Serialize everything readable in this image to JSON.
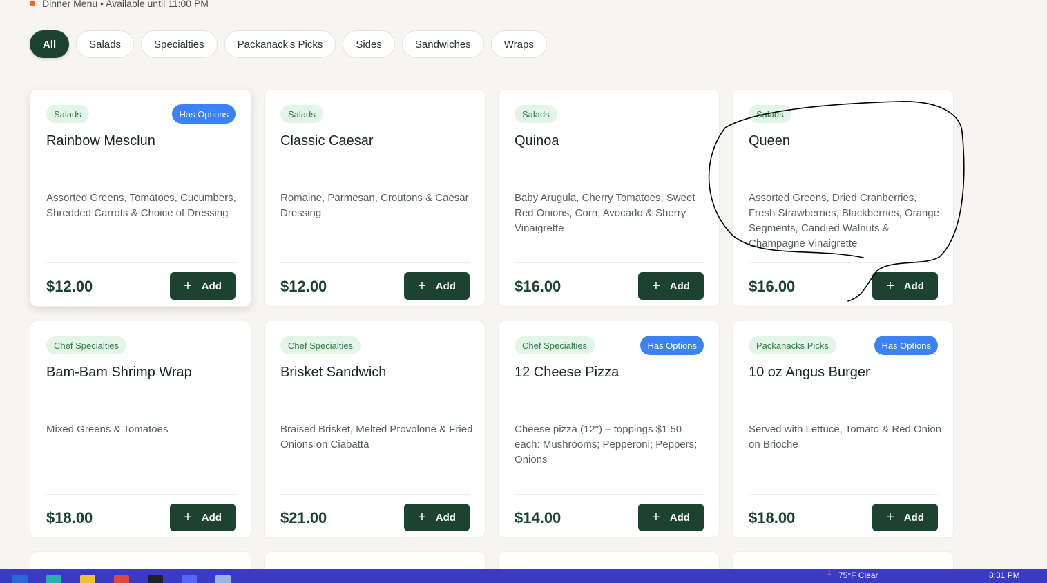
{
  "header": {
    "status_text": "Dinner Menu • Available until 11:00 PM"
  },
  "filters": [
    "All",
    "Salads",
    "Specialties",
    "Packanack's Picks",
    "Sides",
    "Sandwiches",
    "Wraps"
  ],
  "add_label": "Add",
  "items": [
    {
      "category": "Salads",
      "options": "Has Options",
      "name": "Rainbow Mesclun",
      "description": "Assorted Greens, Tomatoes, Cucumbers, Shredded Carrots & Choice of Dressing",
      "price": "$12.00"
    },
    {
      "category": "Salads",
      "options": "",
      "name": "Classic Caesar",
      "description": "Romaine, Parmesan, Croutons & Caesar Dressing",
      "price": "$12.00"
    },
    {
      "category": "Salads",
      "options": "",
      "name": "Quinoa",
      "description": "Baby Arugula, Cherry Tomatoes, Sweet Red Onions, Corn, Avocado & Sherry Vinaigrette",
      "price": "$16.00"
    },
    {
      "category": "Salads",
      "options": "",
      "name": "Queen",
      "description": "Assorted Greens, Dried Cranberries, Fresh Strawberries, Blackberries, Orange Segments, Candied Walnuts & Champagne Vinaigrette",
      "price": "$16.00"
    },
    {
      "category": "Chef Specialties",
      "options": "",
      "name": "Bam-Bam Shrimp Wrap",
      "description": "Mixed Greens & Tomatoes",
      "price": "$18.00"
    },
    {
      "category": "Chef Specialties",
      "options": "",
      "name": "Brisket Sandwich",
      "description": "Braised Brisket, Melted Provolone & Fried Onions on Ciabatta",
      "price": "$21.00"
    },
    {
      "category": "Chef Specialties",
      "options": "Has Options",
      "name": "12 Cheese Pizza",
      "description": "Cheese pizza (12\") – toppings $1.50 each: Mushrooms; Pepperoni; Peppers; Onions",
      "price": "$14.00"
    },
    {
      "category": "Packanacks Picks",
      "options": "Has Options",
      "name": "10 oz Angus Burger",
      "description": "Served with Lettuce, Tomato & Red Onion on Brioche",
      "price": "$18.00"
    }
  ],
  "taskbar": {
    "weather": "75°F Clear",
    "time": "8:31 PM",
    "notification_count": "1"
  },
  "colors": {
    "brand_green": "#1c4230",
    "category_bg": "#e3f5e7",
    "options_blue": "#3b82f6",
    "status_dot": "#f26b1d"
  }
}
